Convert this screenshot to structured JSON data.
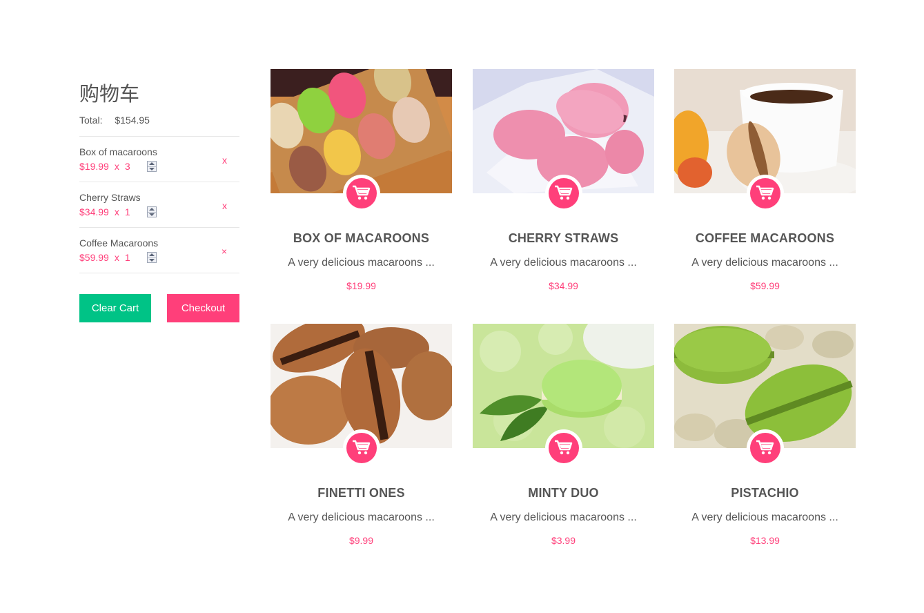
{
  "cart": {
    "title": "购物车",
    "total_label": "Total:",
    "total_value": "$154.95",
    "items": [
      {
        "name": "Box of macaroons",
        "price": "$19.99",
        "times": "x",
        "qty": "3",
        "remove": "x"
      },
      {
        "name": "Cherry Straws",
        "price": "$34.99",
        "times": "x",
        "qty": "1",
        "remove": "x"
      },
      {
        "name": "Coffee Macaroons",
        "price": "$59.99",
        "times": "x",
        "qty": "1",
        "remove": "×"
      }
    ],
    "clear_label": "Clear Cart",
    "checkout_label": "Checkout"
  },
  "products": [
    {
      "name": "BOX OF MACAROONS",
      "desc": "A very delicious macaroons ...",
      "price": "$19.99"
    },
    {
      "name": "CHERRY STRAWS",
      "desc": "A very delicious macaroons ...",
      "price": "$34.99"
    },
    {
      "name": "COFFEE MACAROONS",
      "desc": "A very delicious macaroons ...",
      "price": "$59.99"
    },
    {
      "name": "FINETTI ONES",
      "desc": "A very delicious macaroons ...",
      "price": "$9.99"
    },
    {
      "name": "MINTY DUO",
      "desc": "A very delicious macaroons ...",
      "price": "$3.99"
    },
    {
      "name": "PISTACHIO",
      "desc": "A very delicious macaroons ...",
      "price": "$13.99"
    }
  ],
  "icons": {
    "add_to_cart": "shopping-cart-icon",
    "qty_spinner": "number-spinner-icon"
  },
  "colors": {
    "accent": "#ff3f7a",
    "clear_button": "#00c386",
    "text": "#555555",
    "divider": "#e6e6e6"
  }
}
